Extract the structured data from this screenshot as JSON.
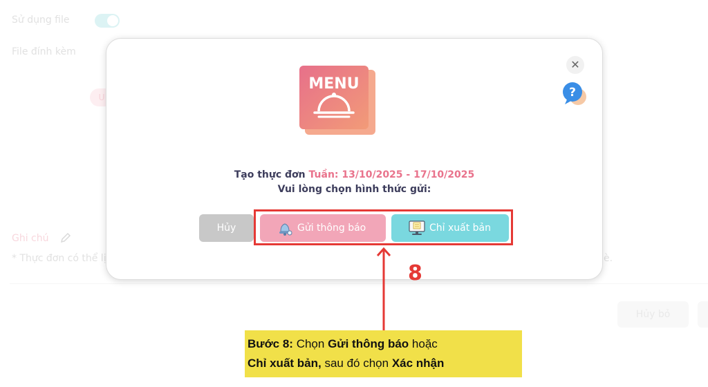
{
  "background": {
    "use_file_label": "Sử dụng file",
    "attachment_label": "File đính kèm",
    "pill_text": "U",
    "note_label": "Ghi chú",
    "note_text": "* Thực đơn có thể lị",
    "note_text_tail": "è.",
    "discard_label": "Hủy bỏ"
  },
  "modal": {
    "menu_icon_text": "MENU",
    "title_prefix": "Tạo thực đơn ",
    "title_week": "Tuần: 13/10/2025 - 17/10/2025",
    "subtitle": "Vui lòng chọn hình thức gửi:",
    "cancel_label": "Hủy",
    "notify_label": "Gửi thông báo",
    "export_label": "Chỉ xuất bản"
  },
  "annotation": {
    "step_number": "8",
    "step_prefix": "Bước 8:",
    "text1": " Chọn ",
    "bold1": "Gửi thông báo",
    "text2": " hoặc",
    "bold2": "Chỉ xuất bản,",
    "text3": " sau đó chọn ",
    "bold3": "Xác nhận"
  },
  "colors": {
    "accent_pink": "#e9738c",
    "notify_button": "#f2a6b8",
    "export_button": "#7ad8df",
    "highlight_red": "#e53935",
    "callout_yellow": "#f1e049"
  },
  "icons": [
    "close-icon",
    "help-icon",
    "menu-cloche-icon",
    "bell-icon",
    "computer-icon",
    "pencil-icon",
    "arrow-up-icon"
  ]
}
